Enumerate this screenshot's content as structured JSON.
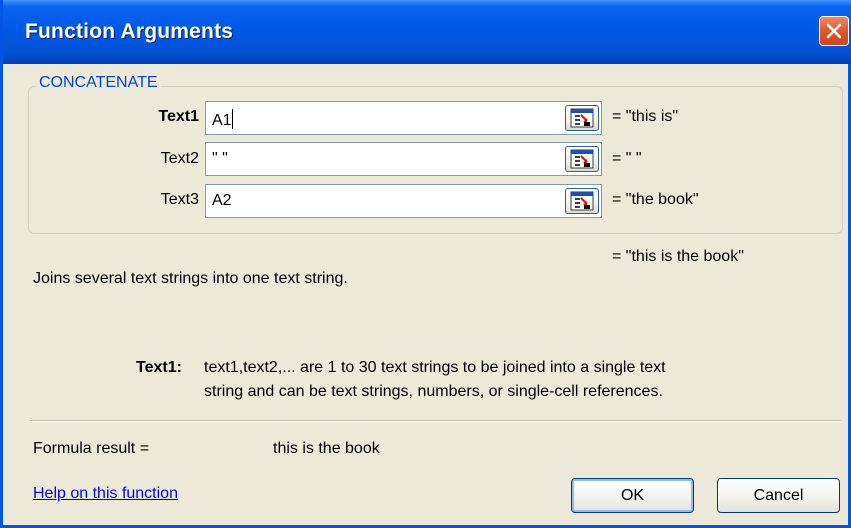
{
  "window": {
    "title": "Function Arguments",
    "close_icon": "close-icon"
  },
  "function": {
    "name": "CONCATENATE",
    "args": [
      {
        "label": "Text1",
        "value": "A1",
        "result": "= \"this is\""
      },
      {
        "label": "Text2",
        "value": "\" \"",
        "result": "= \" \""
      },
      {
        "label": "Text3",
        "value": "A2",
        "result": "= \"the book\""
      }
    ],
    "overall_result": "= \"this is the book\"",
    "description": "Joins several text strings into one text string.",
    "arg_help": {
      "name": "Text1:",
      "line1": "text1,text2,... are 1 to 30 text strings to be joined into a single text",
      "line2": "string and can be text strings, numbers, or single-cell references."
    }
  },
  "formula_result": {
    "label": "Formula result =",
    "value": "this is the book"
  },
  "footer": {
    "help_link": "Help on this function",
    "ok_label": "OK",
    "cancel_label": "Cancel"
  },
  "colors": {
    "titlebar": "#0058e6",
    "dialog_bg": "#ece9d8",
    "group_label": "#0046d5",
    "close_button": "#e35a2d",
    "link": "#0000ee"
  }
}
